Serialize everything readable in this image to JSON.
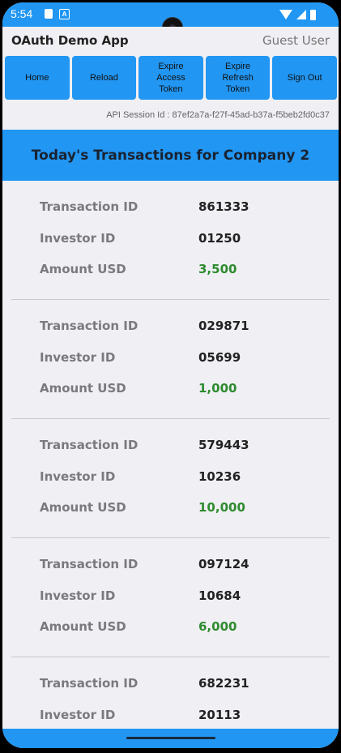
{
  "status_bar": {
    "time": "5:54",
    "left_icons": [
      "sim-card-icon",
      "notification-a-icon"
    ],
    "a_badge": "A",
    "right_icons": [
      "wifi-icon",
      "signal-icon",
      "battery-icon"
    ]
  },
  "app_bar": {
    "title": "OAuth Demo App",
    "user": "Guest User"
  },
  "nav": {
    "buttons": [
      {
        "label": "Home"
      },
      {
        "label": "Reload"
      },
      {
        "label": "Expire\nAccess\nToken"
      },
      {
        "label": "Expire\nRefresh\nToken"
      },
      {
        "label": "Sign Out"
      }
    ]
  },
  "session": {
    "text": "API Session Id : 87ef2a7a-f27f-45ad-b37a-f5beb2fd0c37"
  },
  "header": {
    "title": "Today's Transactions for Company 2"
  },
  "labels": {
    "transaction_id": "Transaction ID",
    "investor_id": "Investor ID",
    "amount_usd": "Amount USD"
  },
  "transactions": [
    {
      "transaction_id": "861333",
      "investor_id": "01250",
      "amount_usd": "3,500"
    },
    {
      "transaction_id": "029871",
      "investor_id": "05699",
      "amount_usd": "1,000"
    },
    {
      "transaction_id": "579443",
      "investor_id": "10236",
      "amount_usd": "10,000"
    },
    {
      "transaction_id": "097124",
      "investor_id": "10684",
      "amount_usd": "6,000"
    },
    {
      "transaction_id": "682231",
      "investor_id": "20113",
      "amount_usd": ""
    }
  ],
  "colors": {
    "accent": "#2196f3",
    "amount": "#2e8b2e",
    "background": "#efeff4"
  }
}
